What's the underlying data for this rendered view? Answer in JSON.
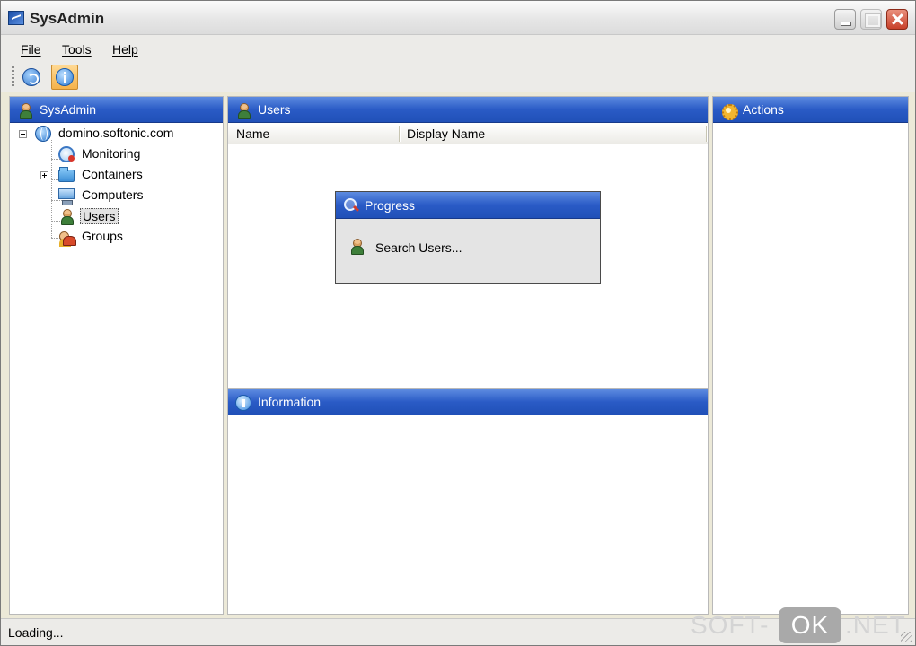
{
  "window": {
    "title": "SysAdmin"
  },
  "menu": {
    "file": "File",
    "tools": "Tools",
    "help": "Help"
  },
  "toolbar": {
    "buttons": [
      {
        "icon": "refresh-icon"
      },
      {
        "icon": "info-icon",
        "active": true
      }
    ]
  },
  "left_panel": {
    "title": "SysAdmin",
    "tree": {
      "root": "domino.softonic.com",
      "children": [
        {
          "label": "Monitoring",
          "icon": "monitoring-icon"
        },
        {
          "label": "Containers",
          "icon": "folder-icon",
          "expandable": true
        },
        {
          "label": "Computers",
          "icon": "computer-icon"
        },
        {
          "label": "Users",
          "icon": "user-icon",
          "selected": true
        },
        {
          "label": "Groups",
          "icon": "groups-icon"
        }
      ]
    }
  },
  "users_panel": {
    "title": "Users",
    "columns": [
      "Name",
      "Display Name"
    ]
  },
  "progress_dialog": {
    "title": "Progress",
    "message": "Search Users..."
  },
  "info_panel": {
    "title": "Information"
  },
  "actions_panel": {
    "title": "Actions"
  },
  "status": {
    "text": "Loading..."
  },
  "watermark": {
    "left": "SOFT-",
    "box": "OK",
    "right": ".NET"
  },
  "colors": {
    "header_blue": "#2a5bc6",
    "selection": "#e3e3e3"
  }
}
